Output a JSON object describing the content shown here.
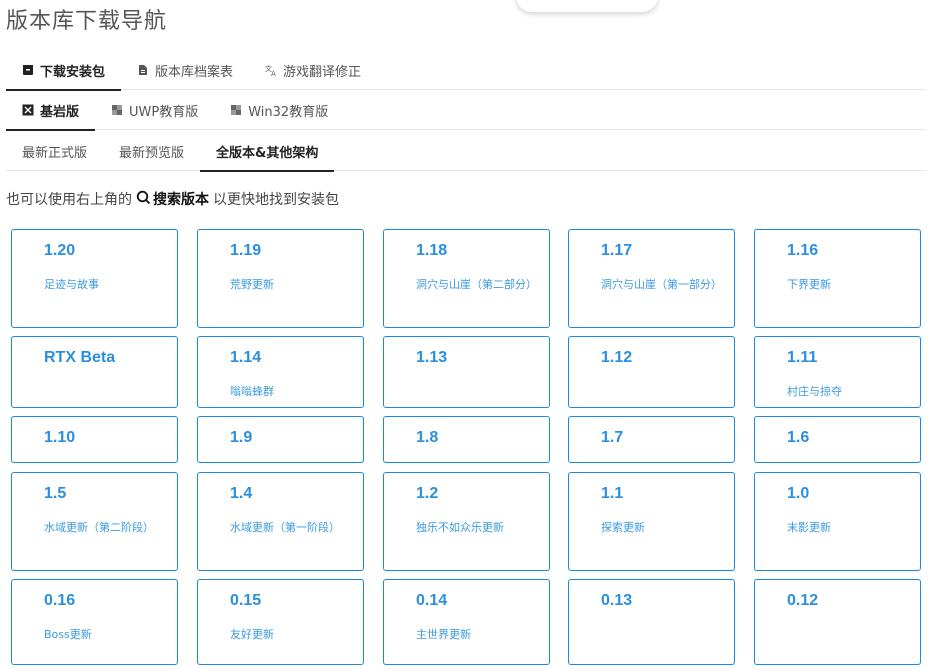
{
  "page": {
    "title": "版本库下载导航"
  },
  "tabs_main": [
    {
      "label": "下载安装包",
      "icon": "package-icon",
      "active": true
    },
    {
      "label": "版本库档案表",
      "icon": "document-icon",
      "active": false
    },
    {
      "label": "游戏翻译修正",
      "icon": "translate-icon",
      "active": false
    }
  ],
  "tabs_edition": [
    {
      "label": "基岩版",
      "icon": "bedrock-icon",
      "active": true
    },
    {
      "label": "UWP教育版",
      "icon": "education-icon",
      "active": false
    },
    {
      "label": "Win32教育版",
      "icon": "education-icon",
      "active": false
    }
  ],
  "tabs_channel": [
    {
      "label": "最新正式版",
      "active": false
    },
    {
      "label": "最新预览版",
      "active": false
    },
    {
      "label": "全版本&其他架构",
      "active": true
    }
  ],
  "hint": {
    "before": "也可以使用右上角的",
    "strong": "搜索版本",
    "after": "以更快地找到安装包"
  },
  "versions": [
    {
      "version": "1.20",
      "name": "足迹与故事"
    },
    {
      "version": "1.19",
      "name": "荒野更新"
    },
    {
      "version": "1.18",
      "name": "洞穴与山崖（第二部分）"
    },
    {
      "version": "1.17",
      "name": "洞穴与山崖（第一部分）"
    },
    {
      "version": "1.16",
      "name": "下界更新"
    },
    {
      "version": "RTX Beta",
      "name": ""
    },
    {
      "version": "1.14",
      "name": "嗡嗡蜂群"
    },
    {
      "version": "1.13",
      "name": ""
    },
    {
      "version": "1.12",
      "name": ""
    },
    {
      "version": "1.11",
      "name": "村庄与掠夺"
    },
    {
      "version": "1.10",
      "name": ""
    },
    {
      "version": "1.9",
      "name": ""
    },
    {
      "version": "1.8",
      "name": ""
    },
    {
      "version": "1.7",
      "name": ""
    },
    {
      "version": "1.6",
      "name": ""
    },
    {
      "version": "1.5",
      "name": "水域更新（第二阶段）"
    },
    {
      "version": "1.4",
      "name": "水域更新（第一阶段）"
    },
    {
      "version": "1.2",
      "name": "独乐不如众乐更新"
    },
    {
      "version": "1.1",
      "name": "探索更新"
    },
    {
      "version": "1.0",
      "name": "末影更新"
    },
    {
      "version": "0.16",
      "name": "Boss更新"
    },
    {
      "version": "0.15",
      "name": "友好更新"
    },
    {
      "version": "0.14",
      "name": "主世界更新"
    },
    {
      "version": "0.13",
      "name": ""
    },
    {
      "version": "0.12",
      "name": ""
    }
  ],
  "colors": {
    "accent": "#2b8fde",
    "card_border": "#1a8ae0",
    "tab_active": "#222222"
  }
}
